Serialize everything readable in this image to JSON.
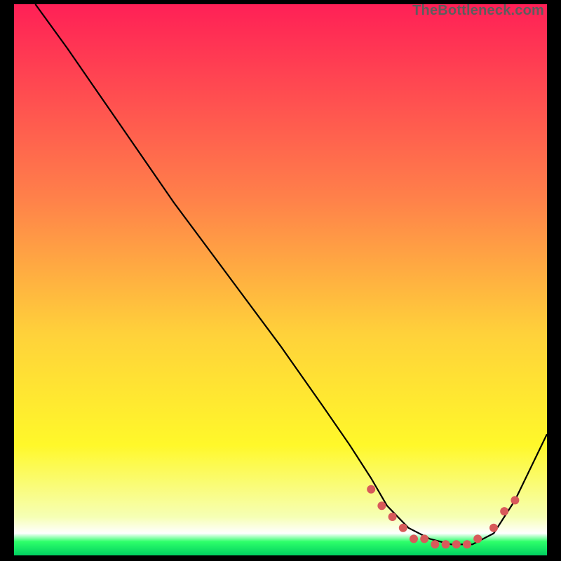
{
  "watermark": "TheBottleneck.com",
  "chart_data": {
    "type": "line",
    "title": "",
    "xlabel": "",
    "ylabel": "",
    "xlim": [
      0,
      100
    ],
    "ylim": [
      0,
      100
    ],
    "grid": false,
    "series": [
      {
        "name": "bottleneck-curve",
        "color": "#000000",
        "x": [
          4,
          10,
          20,
          30,
          40,
          50,
          58,
          63,
          67,
          70,
          74,
          78,
          82,
          86,
          90,
          94,
          100
        ],
        "y": [
          100,
          92,
          78,
          64,
          51,
          38,
          27,
          20,
          14,
          9,
          5,
          3,
          2,
          2,
          4,
          10,
          22
        ]
      },
      {
        "name": "highlight-dots",
        "color": "#d85a5a",
        "style": "points",
        "x": [
          67,
          69,
          71,
          73,
          75,
          77,
          79,
          81,
          83,
          85,
          87,
          90,
          92,
          94
        ],
        "y": [
          12,
          9,
          7,
          5,
          3,
          3,
          2,
          2,
          2,
          2,
          3,
          5,
          8,
          10
        ]
      }
    ],
    "background_gradient": {
      "stops": [
        {
          "offset": 0.0,
          "color": "#ff2056"
        },
        {
          "offset": 0.35,
          "color": "#ff804a"
        },
        {
          "offset": 0.6,
          "color": "#ffd23a"
        },
        {
          "offset": 0.8,
          "color": "#fff82a"
        },
        {
          "offset": 0.93,
          "color": "#f6ffb4"
        },
        {
          "offset": 0.96,
          "color": "#ffffff"
        },
        {
          "offset": 0.975,
          "color": "#2eff6a"
        },
        {
          "offset": 1.0,
          "color": "#00d060"
        }
      ]
    }
  }
}
